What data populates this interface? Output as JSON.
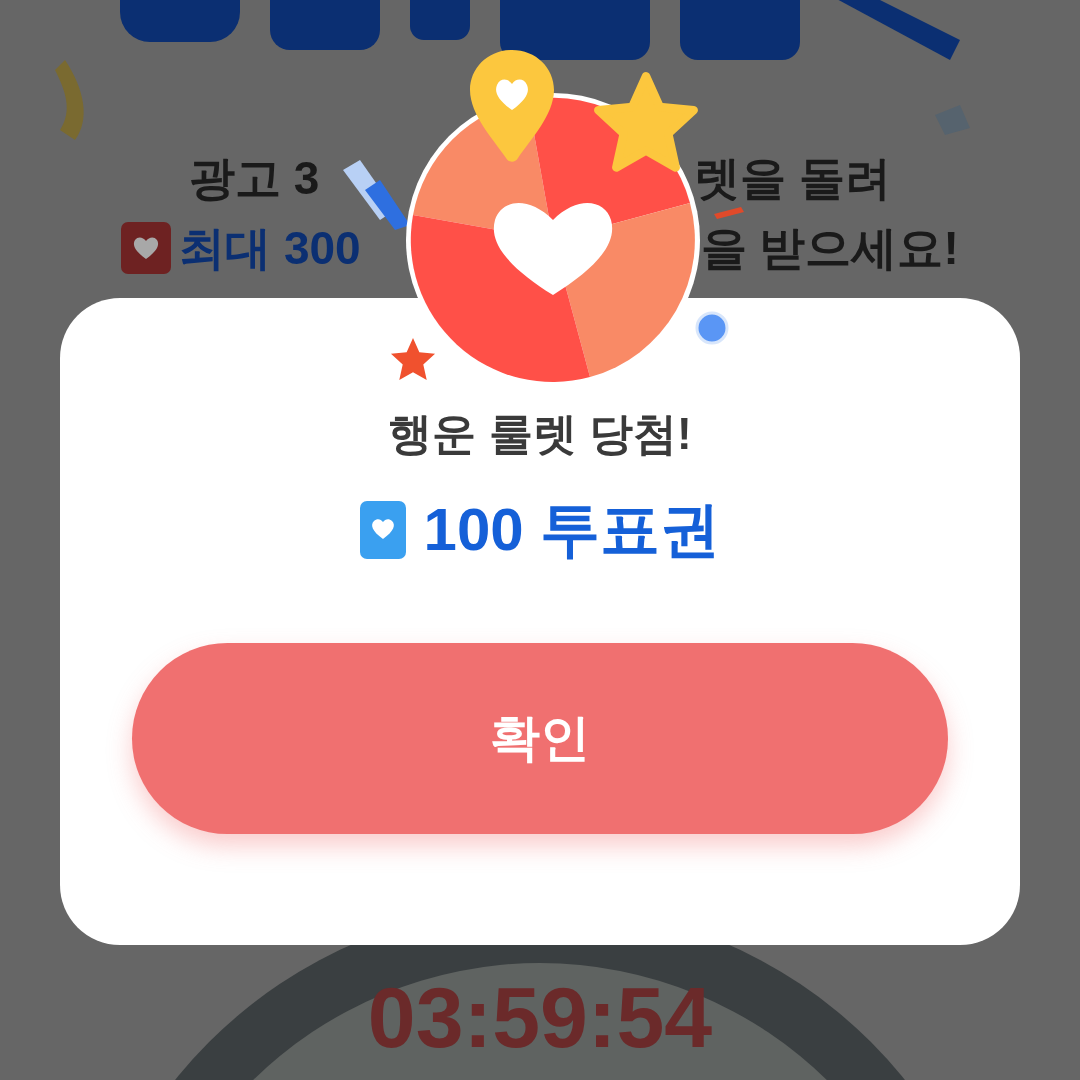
{
  "background": {
    "lines": [
      {
        "kind": "plain",
        "left": "광고 3",
        "right": "렛을 돌려"
      },
      {
        "kind": "highlight",
        "left": "최대 300",
        "right": "을 받으세요!"
      }
    ],
    "timer": "03:59:54"
  },
  "dialog": {
    "title": "행운 룰렛 당첨!",
    "reward": "100 투표권",
    "button": "확인"
  }
}
